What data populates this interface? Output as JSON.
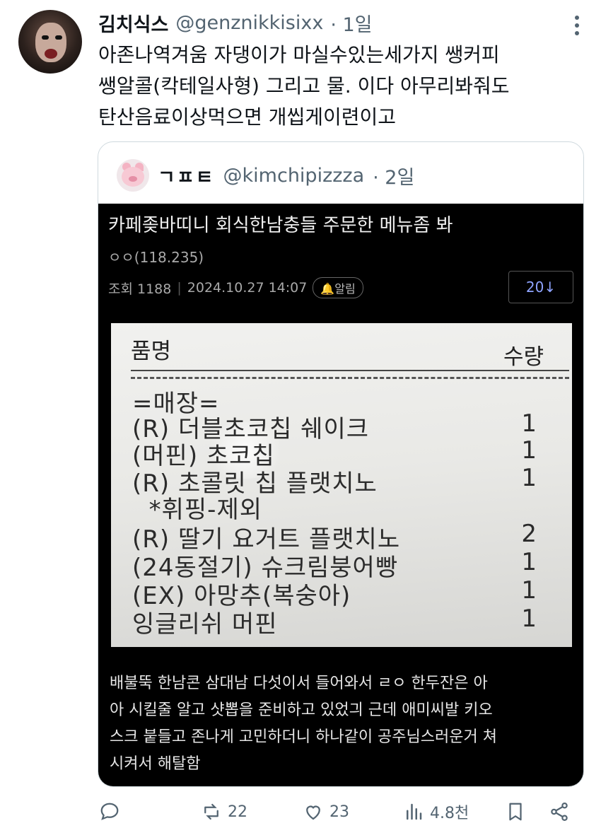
{
  "tweet": {
    "author_name": "김치식스",
    "author_handle": "@genznikkisixx",
    "time": "· 1일",
    "text_lines": [
      "아존나역겨움 자댕이가 마실수있는세가지 쌩커피",
      "쌩알콜(칵테일사형) 그리고 물. 이다 아무리봐줘도",
      "탄산음료이상먹으면 개씹게이련이고"
    ]
  },
  "quote": {
    "author_name": "ㄱㅍㅌ",
    "author_handle": "@kimchipizzza",
    "time": "· 2일",
    "post": {
      "title": "카페좆바띠니 회식한남충들 주문한 메뉴좀 봐",
      "author": "ㅇㅇ(118.235)",
      "views_label": "조회 1188",
      "datetime": "2024.10.27 14:07",
      "alert_label": "알림",
      "count_button": "20↓",
      "receipt": {
        "header_item": "품명",
        "header_qty": "수량",
        "section": "=매장=",
        "rows": [
          {
            "name": "(R) 더블초코칩 쉐이크",
            "qty": "1"
          },
          {
            "name": "(머핀) 초코칩",
            "qty": "1"
          },
          {
            "name": "(R) 초콜릿 칩 플랫치노",
            "qty": "1"
          },
          {
            "name": "  *휘핑-제외",
            "qty": ""
          },
          {
            "name": "(R) 딸기 요거트 플랫치노",
            "qty": "2"
          },
          {
            "name": "(24동절기) 슈크림붕어빵",
            "qty": "1"
          },
          {
            "name": "(EX) 아망추(복숭아)",
            "qty": "1"
          },
          {
            "name": "잉글리쉬 머핀",
            "qty": "1"
          }
        ]
      },
      "body_lines": [
        "배불뚝 한남콘 삼대남 다섯이서 들어와서 ㄹㅇ 한두잔은 아",
        "아 시킬줄 알고 샷뽑을 준비하고 있었긔 근데 애미씨발 키오",
        "스크 붙들고 존나게 고민하더니 하나같이 공주님스러운거 쳐",
        "시켜서 해탈함"
      ]
    }
  },
  "actions": {
    "reply_count": "",
    "retweet_count": "22",
    "like_count": "23",
    "views_count": "4.8천"
  },
  "colors": {
    "text_primary": "#0f1419",
    "text_secondary": "#536471",
    "border": "#cfd9de",
    "link_blue": "#8fa4ff"
  }
}
